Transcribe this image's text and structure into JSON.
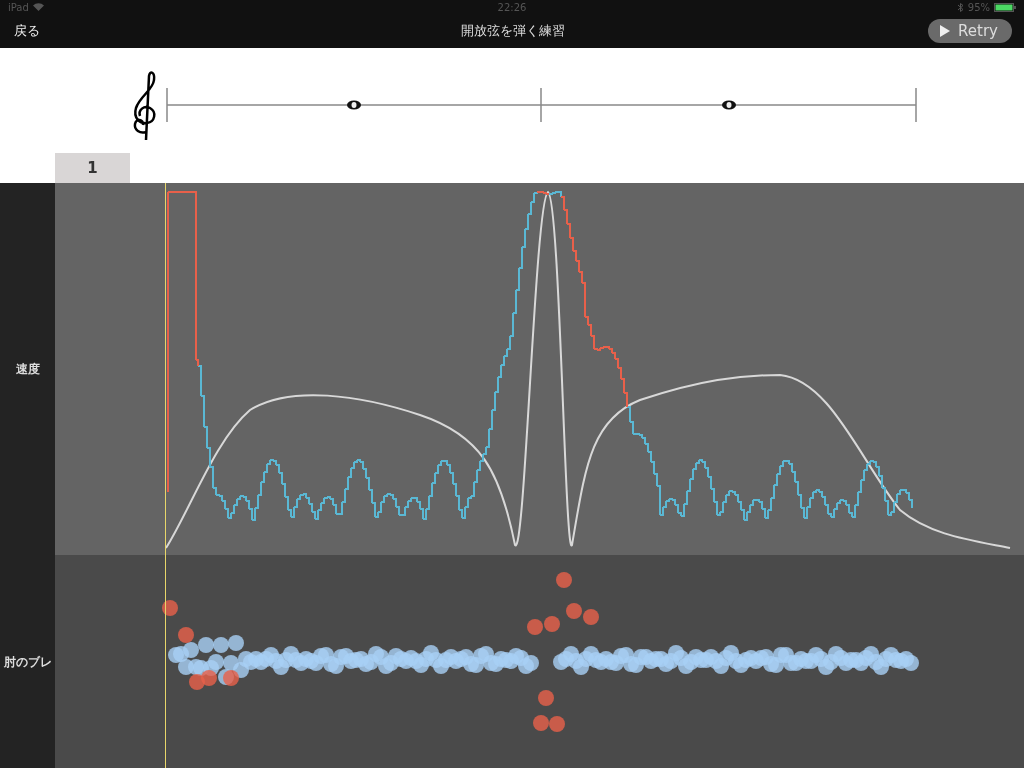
{
  "status_bar": {
    "device": "iPad",
    "time": "22:26",
    "battery": "95%"
  },
  "nav": {
    "back": "戻る",
    "title": "開放弦を弾く練習",
    "retry": "Retry"
  },
  "measures": [
    {
      "label": "1"
    }
  ],
  "rows": [
    {
      "label": "速度",
      "kind": "line"
    },
    {
      "label": "肘のブレ",
      "kind": "scatter"
    }
  ]
}
